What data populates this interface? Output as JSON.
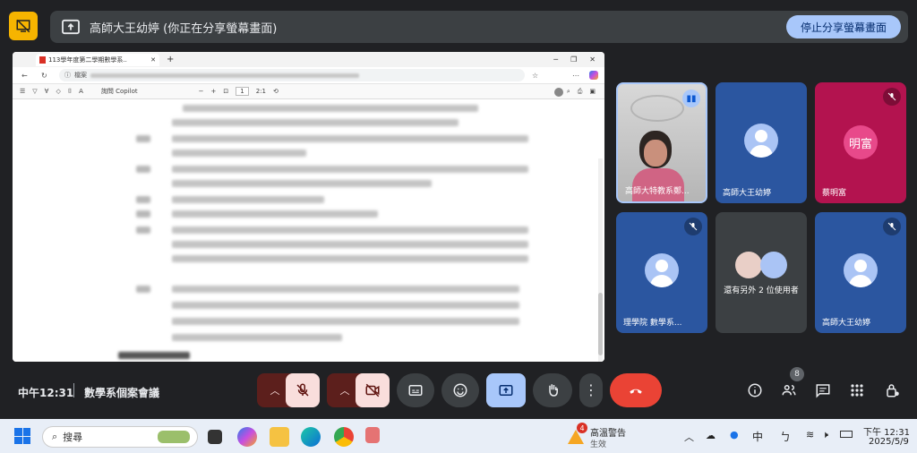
{
  "banner": {
    "title": "高師大王幼婷 (你正在分享螢幕畫面)",
    "stop_button": "停止分享螢幕畫面"
  },
  "browser": {
    "tab_title": "113學年度第二學期數學系..",
    "address_label": "檔案",
    "pdf_copilot_label": "詢問 Copilot",
    "pdf_page_number": "1",
    "pdf_zoom_label": "2:1"
  },
  "tiles": [
    {
      "name": "高師大特教系鄭...",
      "type": "video",
      "speaking": true
    },
    {
      "name": "高師大王幼婷",
      "type": "avatar",
      "color": "#2b56a0"
    },
    {
      "name": "蔡明富",
      "type": "initials",
      "initials": "明富",
      "muted": true,
      "color": "#b3134f"
    },
    {
      "name": "理學院 數學系...",
      "type": "avatar",
      "muted": true,
      "color": "#2b56a0"
    },
    {
      "name": "還有另外 2 位使用者",
      "type": "others",
      "color": "#3c4043"
    },
    {
      "name": "高師大王幼婷",
      "type": "avatar",
      "muted": true,
      "color": "#2b56a0"
    }
  ],
  "meeting": {
    "time": "中午12:31",
    "name": "數學系個案會議",
    "participants_count": "8"
  },
  "taskbar": {
    "search_placeholder": "搜尋",
    "weather_title": "高溫警告",
    "weather_sub": "生效",
    "weather_badge": "4",
    "ime_char": "中",
    "clock_time": "下午 12:31",
    "clock_date": "2025/5/9"
  },
  "colors": {
    "accent": "#a8c7fa",
    "end_call": "#ea4335",
    "muted_bg": "#f9dedc",
    "corner": "#f6b400"
  }
}
